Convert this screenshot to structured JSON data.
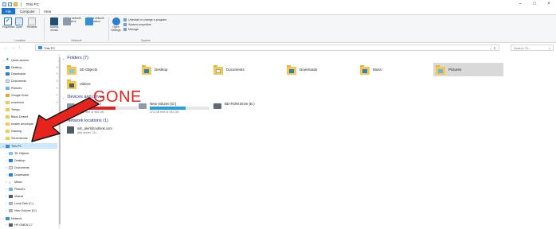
{
  "window": {
    "title": "This PC",
    "controls": {
      "minimize": "–",
      "maximize": "□",
      "close": "×"
    }
  },
  "ribbon": {
    "tabs": [
      "File",
      "Computer",
      "View"
    ],
    "groups": {
      "location": {
        "label": "Location",
        "buttons": [
          "Properties",
          "Open",
          "Rename"
        ]
      },
      "network": {
        "label": "Network",
        "buttons": [
          "Access media",
          "Map network drive",
          "Add a network location"
        ]
      },
      "system": {
        "label": "System",
        "open_settings": "Open Settings",
        "items": [
          "Uninstall or change a program",
          "System properties",
          "Manage"
        ]
      }
    }
  },
  "address_bar": {
    "nav": [
      "←",
      "→",
      "↑"
    ],
    "path": "This PC",
    "dropdown": "⌄",
    "refresh": "↻",
    "search_placeholder": "Search Th..."
  },
  "sidebar": {
    "quick_access": "Quick access",
    "quick_items": [
      "Desktop",
      "Downloads",
      "Documents",
      "Pictures",
      "Google Drive",
      "screenion",
      "Temps",
      "Black Desert",
      "enable developer",
      "Gaming",
      "Screenshots"
    ],
    "this_pc": "This PC",
    "pc_items": [
      "3D Objects",
      "Desktop",
      "Documents",
      "Downloads",
      "Music",
      "Pictures",
      "Videos",
      "Local Disk (C:)",
      "New Volume (D:)"
    ],
    "network": "Network",
    "network_items": [
      "HP-OMEN-17"
    ]
  },
  "main": {
    "folders_heading": "Folders (7)",
    "folders": [
      "3D Objects",
      "Desktop",
      "Documents",
      "Downloads",
      "Music",
      "Pictures",
      "Videos"
    ],
    "devices_heading": "Devices and drives",
    "drives": [
      {
        "name": "Local Disk (C:)",
        "free": "...GB free of 464 GB",
        "used_fraction": 0.62,
        "bar_color": "#da2626"
      },
      {
        "name": "New Volume (D:)",
        "free": "374 GB free of 931 GB",
        "used_fraction": 0.6,
        "bar_color": "#26a0da"
      },
      {
        "name": "BD-ROM Drive (E:)",
        "free": "",
        "used_fraction": null,
        "bar_color": ""
      }
    ],
    "network_heading": "Network locations (1)",
    "network_locations": [
      {
        "name": "sdc_alert@outlook.com",
        "sub": "(My server: 11)"
      }
    ]
  },
  "annotation": {
    "text": "GONE",
    "color": "#e8231d"
  }
}
